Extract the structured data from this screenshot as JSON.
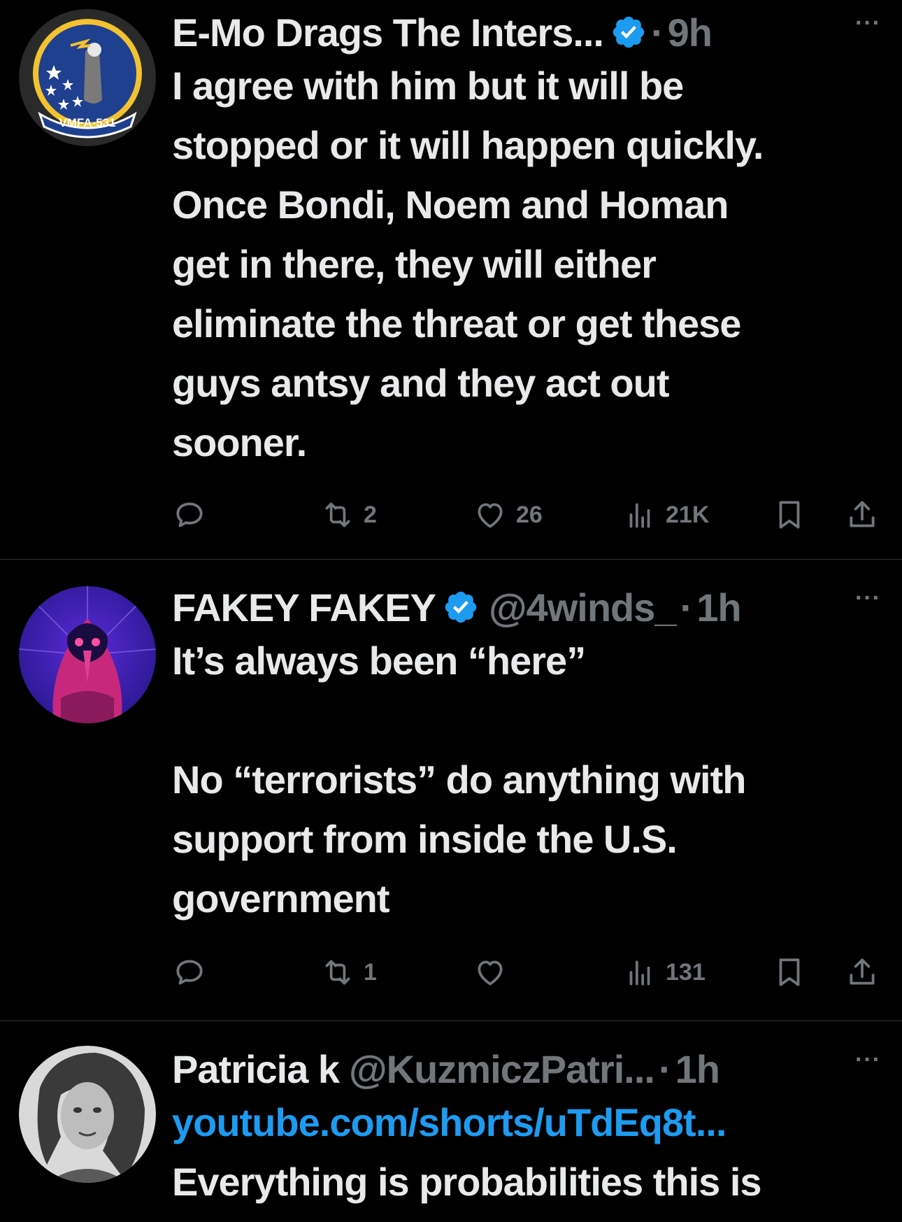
{
  "tweets": [
    {
      "name": "E-Mo Drags The Inters...",
      "handle": "",
      "time": "9h",
      "text_lines": [
        "I agree with him but it will be",
        "stopped or it will happen quickly.",
        "Once Bondi, Noem and Homan",
        "get in there, they will either",
        "eliminate the threat or get these",
        "guys antsy and they act out",
        "sooner."
      ],
      "avatar_text": "VMFA-531",
      "replies": "",
      "retweets": "2",
      "likes": "26",
      "views": "21K"
    },
    {
      "name": "FAKEY FAKEY",
      "handle": "@4winds_",
      "time": "1h",
      "para1": "It’s always been “here”",
      "para2_lines": [
        "No “terrorists” do anything with",
        "support from inside the U.S.",
        "government"
      ],
      "replies": "",
      "retweets": "1",
      "likes": "",
      "views": "131"
    },
    {
      "name": "Patricia k",
      "handle": "@KuzmiczPatri...",
      "time": "1h",
      "link": "youtube.com/shorts/uTdEq8t...",
      "text_line": "Everything is probabilities this is"
    }
  ],
  "separator": "·",
  "more_label": "···",
  "colors": {
    "background": "#000000",
    "text": "#e7e9ea",
    "secondary": "#71767b",
    "verified": "#1d9bf0",
    "link": "#1d9bf0",
    "divider": "#2f3336"
  },
  "icons": [
    "reply-icon",
    "retweet-icon",
    "like-icon",
    "views-icon",
    "bookmark-icon",
    "share-icon",
    "verified-badge-icon",
    "more-icon"
  ]
}
